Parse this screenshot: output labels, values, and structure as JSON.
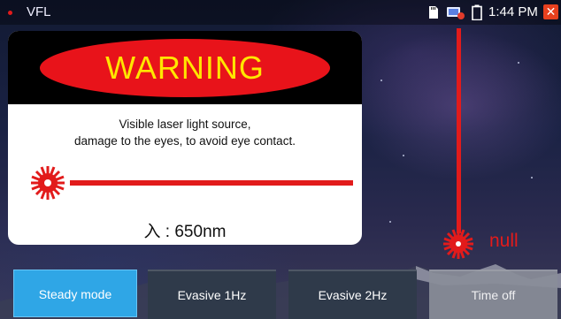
{
  "statusbar": {
    "app_title": "VFL",
    "time": "1:44 PM",
    "icons": [
      "sd-card-icon",
      "usb-icon",
      "battery-icon",
      "close-icon"
    ]
  },
  "warning_card": {
    "title": "WARNING",
    "description_line1": "Visible laser light source,",
    "description_line2": "damage to the eyes, to avoid eye contact.",
    "wavelength": "入 : 650nm"
  },
  "beam": {
    "status_label": "null"
  },
  "mode_buttons": [
    {
      "label": "Steady mode",
      "selected": true
    },
    {
      "label": "Evasive 1Hz",
      "selected": false
    },
    {
      "label": "Evasive 2Hz",
      "selected": false
    },
    {
      "label": "Time off",
      "selected": false
    }
  ],
  "colors": {
    "warning_red": "#e8131a",
    "warning_yellow": "#ffe600",
    "selected_button": "#2fa6e6",
    "laser_red": "#e21b1b"
  }
}
